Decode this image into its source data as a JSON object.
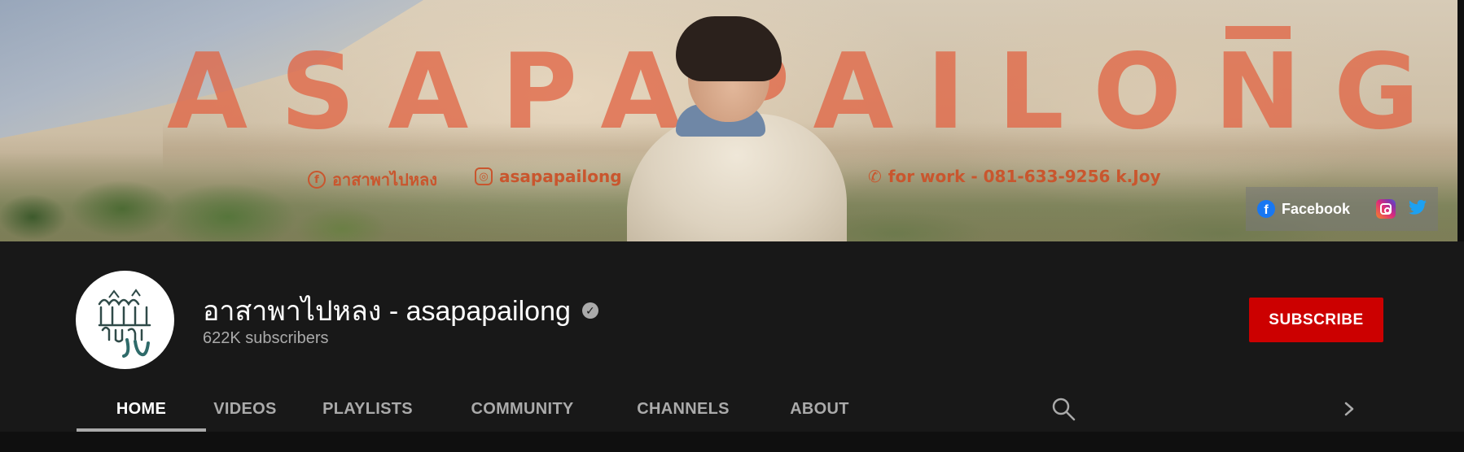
{
  "banner": {
    "brand_text": "ASAPAPAILONG",
    "facebook_handle": "อาสาพาไปหลง",
    "instagram_handle": "asapapailong",
    "work_contact": "for work - 081-633-9256 k.Joy",
    "links": {
      "facebook_label": "Facebook",
      "facebook_icon": "facebook-icon",
      "instagram_icon": "instagram-icon",
      "twitter_icon": "twitter-icon"
    }
  },
  "channel": {
    "name": "อาสาพาไปหลง - asapapailong",
    "verified_icon": "verified-check-icon",
    "subscribers": "622K subscribers",
    "subscribe_label": "SUBSCRIBE",
    "subscribe_color": "#cc0000"
  },
  "tabs": [
    {
      "label": "HOME",
      "active": true
    },
    {
      "label": "VIDEOS",
      "active": false
    },
    {
      "label": "PLAYLISTS",
      "active": false
    },
    {
      "label": "COMMUNITY",
      "active": false
    },
    {
      "label": "CHANNELS",
      "active": false
    },
    {
      "label": "ABOUT",
      "active": false
    }
  ],
  "tab_icons": {
    "search": "search-icon",
    "next": "chevron-right-icon"
  },
  "colors": {
    "background": "#181818",
    "brand_orange": "#e06646",
    "secondary_text": "#aaaaaa"
  }
}
